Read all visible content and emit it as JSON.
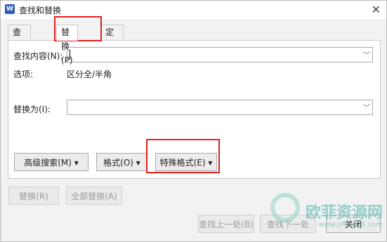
{
  "window": {
    "title": "查找和替换",
    "app_icon": "W"
  },
  "tabs": [
    {
      "label": "查找(D)"
    },
    {
      "label": "替换(P)"
    },
    {
      "label": "定位(G)"
    }
  ],
  "find": {
    "label": "查找内容(N):",
    "value": ""
  },
  "options": {
    "label": "选项:",
    "value": "区分全/半角"
  },
  "replace": {
    "label": "替换为(I):",
    "value": ""
  },
  "buttons": {
    "advanced": "高级搜索(M)",
    "format": "格式(O)",
    "special": "特殊格式(E)",
    "replace_one": "替换(R)",
    "replace_all": "全部替换(A)",
    "find_prev": "查找上一处(B)",
    "find_next": "查找下一处",
    "close": "关闭"
  },
  "watermark": {
    "text": "欧菲资源网",
    "url": "www.office26.com"
  },
  "colors": {
    "highlight": "#e02020"
  }
}
